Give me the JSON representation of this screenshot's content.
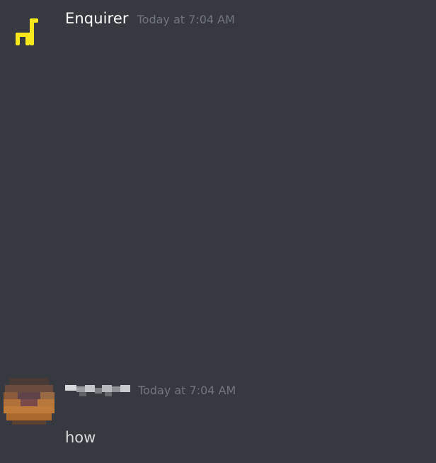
{
  "messages": [
    {
      "username": "Enquirer",
      "timestamp": "Today at 7:04 AM",
      "avatar_icon": "llama-bot-icon",
      "avatar_color": "#f7e81c",
      "content": ""
    },
    {
      "username": "",
      "username_redacted": true,
      "timestamp": "Today at 7:04 AM",
      "avatar_icon": "pixelated-user-avatar",
      "content": "how"
    }
  ],
  "colors": {
    "background": "#36393f",
    "username": "#ffffff",
    "timestamp": "#72767d",
    "message_text": "#dcddde"
  }
}
